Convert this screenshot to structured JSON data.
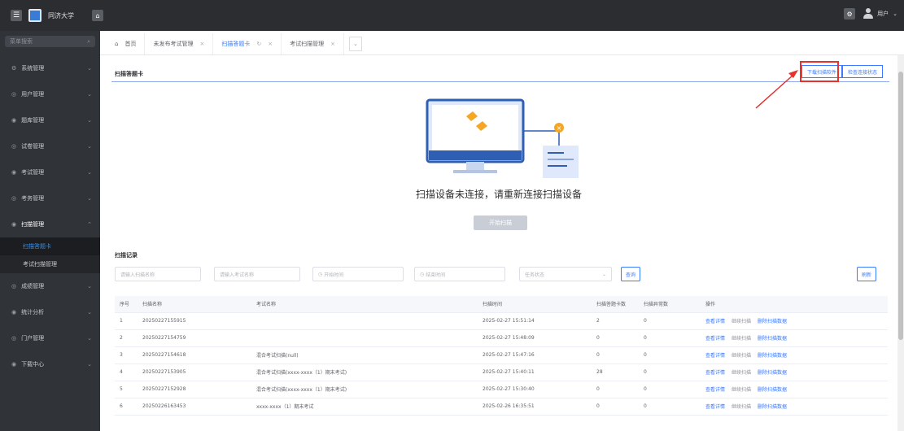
{
  "topbar": {
    "brand": "同济大学",
    "menu_icon": "☰",
    "home_icon": "⌂",
    "gear_icon": "⚙",
    "username": "用户",
    "caret": "⌄"
  },
  "sidebar": {
    "search_placeholder": "菜单搜索",
    "search_icon": "⌕",
    "items": [
      {
        "label": "系统管理",
        "icon": "⚙"
      },
      {
        "label": "用户管理",
        "icon": "◎"
      },
      {
        "label": "题库管理",
        "icon": "◉"
      },
      {
        "label": "试卷管理",
        "icon": "◎"
      },
      {
        "label": "考试管理",
        "icon": "◉"
      },
      {
        "label": "考务管理",
        "icon": "◎"
      },
      {
        "label": "扫描管理",
        "icon": "◉"
      },
      {
        "label": "成绩管理",
        "icon": "◎"
      },
      {
        "label": "统计分析",
        "icon": "◉"
      },
      {
        "label": "门户管理",
        "icon": "◎"
      },
      {
        "label": "下载中心",
        "icon": "◉"
      }
    ],
    "sub_items": [
      {
        "label": "扫描答题卡"
      },
      {
        "label": "考试扫描管理"
      }
    ]
  },
  "tabs": [
    {
      "label": "首页",
      "closable": false
    },
    {
      "label": "未发布考试管理",
      "closable": true
    },
    {
      "label": "扫描答题卡",
      "closable": true
    },
    {
      "label": "考试扫描管理",
      "closable": true
    }
  ],
  "tab_close": "×",
  "tab_more": "⌄",
  "card": {
    "title": "扫描答题卡",
    "download_btn": "下载扫描软件",
    "check_btn": "检查连接状态",
    "empty_text": "扫描设备未连接，请重新连接扫描设备",
    "start_btn": "开始扫描"
  },
  "records": {
    "title": "扫描记录",
    "filters": {
      "name_placeholder": "请输入扫描名称",
      "exam_placeholder": "请输入考试名称",
      "start_placeholder": "开始时间",
      "end_placeholder": "结束时间",
      "status_placeholder": "任务状态",
      "search_btn": "查询",
      "refresh_btn": "刷新"
    },
    "columns": [
      "序号",
      "扫描名称",
      "考试名称",
      "扫描时间",
      "扫描答题卡数",
      "扫描异常数",
      "操作"
    ],
    "rows": [
      {
        "no": "1",
        "name": "20250227155915",
        "exam": "",
        "time": "2025-02-27 15:51:14",
        "count": "2",
        "abnormal": "0"
      },
      {
        "no": "2",
        "name": "20250227154759",
        "exam": "",
        "time": "2025-02-27 15:48:09",
        "count": "0",
        "abnormal": "0"
      },
      {
        "no": "3",
        "name": "20250227154618",
        "exam": "混合考试扫描(null)",
        "time": "2025-02-27 15:47:16",
        "count": "0",
        "abnormal": "0"
      },
      {
        "no": "4",
        "name": "20250227153905",
        "exam": "混合考试扫描(xxxx-xxxx（1）期末考试)",
        "time": "2025-02-27 15:40:11",
        "count": "28",
        "abnormal": "0"
      },
      {
        "no": "5",
        "name": "20250227152928",
        "exam": "混合考试扫描(xxxx-xxxx（1）期末考试)",
        "time": "2025-02-27 15:30:40",
        "count": "0",
        "abnormal": "0"
      },
      {
        "no": "6",
        "name": "20250226163453",
        "exam": "xxxx-xxxx（1）期末考试",
        "time": "2025-02-26 16:35:51",
        "count": "0",
        "abnormal": "0"
      }
    ],
    "ops": {
      "detail": "查看详情",
      "continue": "继续扫描",
      "delete": "删除扫描数据"
    }
  }
}
